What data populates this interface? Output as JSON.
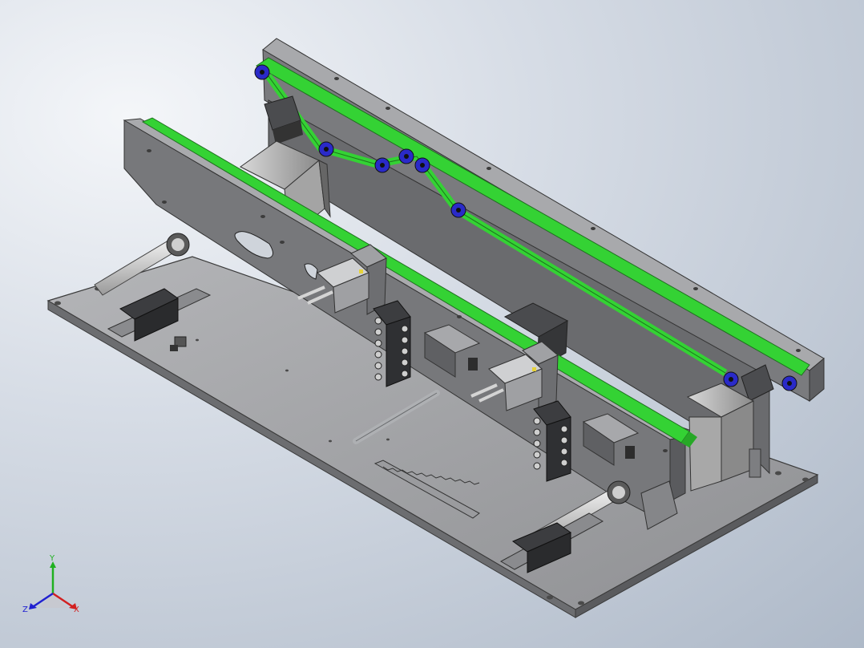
{
  "view": {
    "background_top": "#f4f6f9",
    "background_bottom": "#aeb9c8",
    "metal_color": "#8c8d90",
    "metal_dark": "#5c5d60",
    "belt_color": "#34d234",
    "roller_color": "#2a2ac8"
  },
  "triad": {
    "x_label": "X",
    "y_label": "Y",
    "z_label": "Z",
    "x_color": "#d22020",
    "y_color": "#20b020",
    "z_color": "#2020d0"
  }
}
